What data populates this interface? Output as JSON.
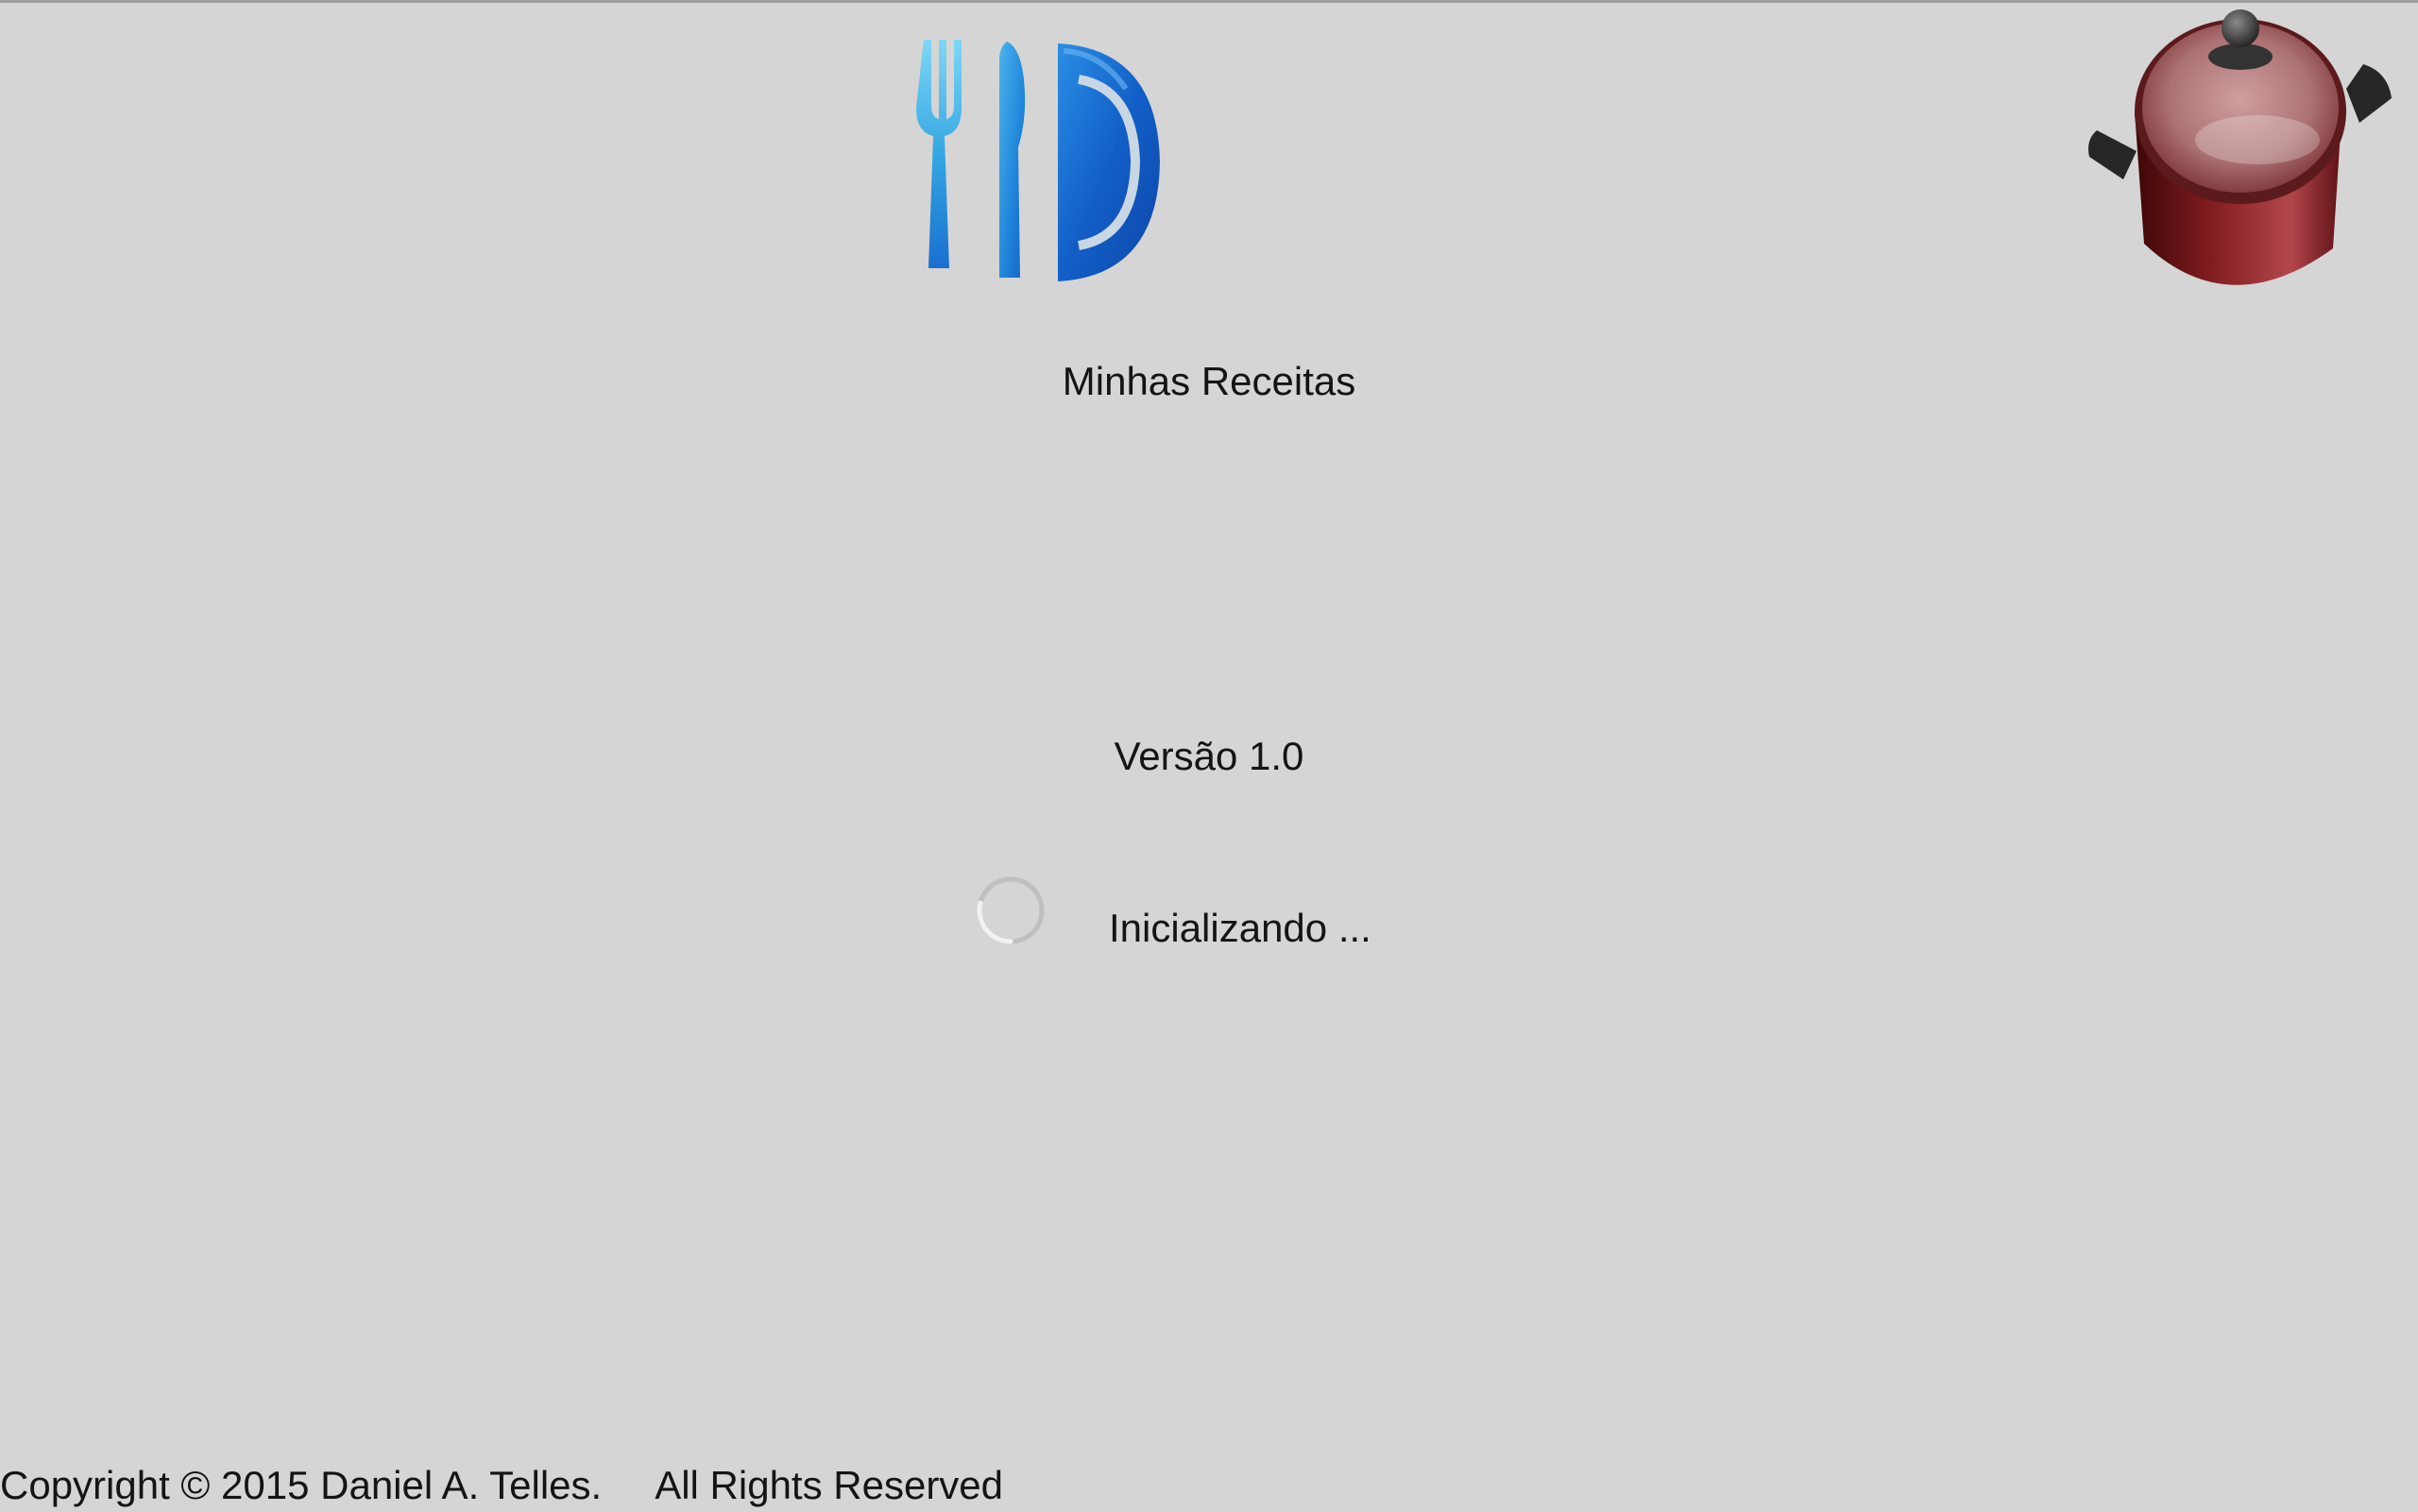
{
  "app": {
    "title": "Minhas Receitas",
    "version_label": "Versão 1.0",
    "status": "Inicializando ..."
  },
  "footer": {
    "copyright": "Copyright  © 2015 Daniel A. Telles.",
    "rights": "All Rights Reserved"
  },
  "icons": {
    "logo": "fork-knife-plate-icon",
    "pot": "cooking-pot-icon",
    "spinner": "loading-spinner-icon"
  },
  "colors": {
    "background": "#d5d5d5",
    "text": "#141414",
    "logo_blue": "#1a6fd0",
    "pot_red": "#8e2228"
  }
}
